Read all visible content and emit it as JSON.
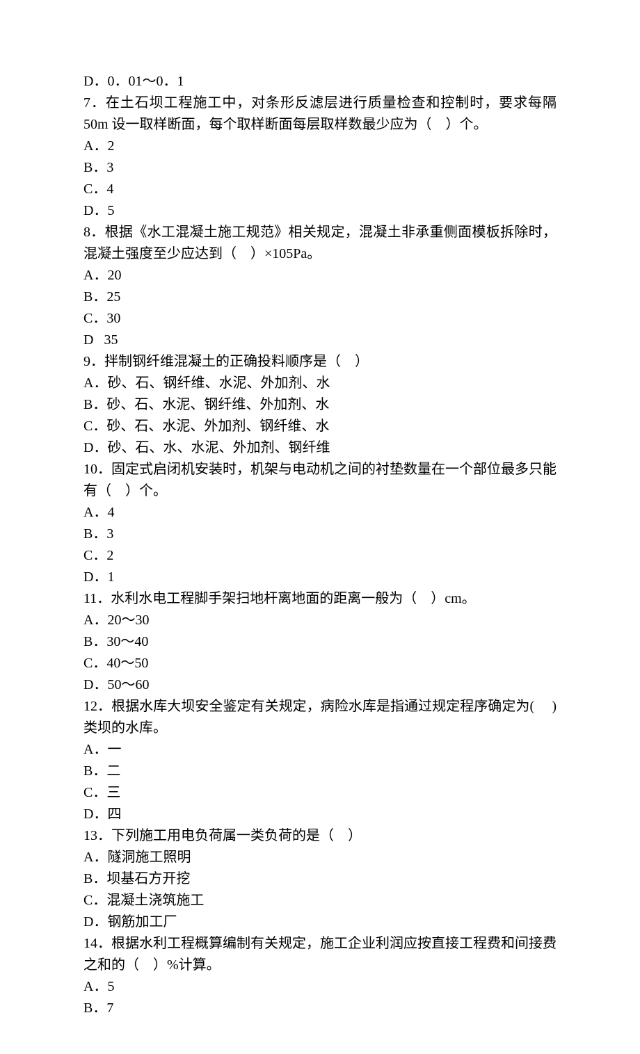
{
  "q6_tail": {
    "optD": "D．0．01～0．1"
  },
  "q7": {
    "stem": "7．在土石坝工程施工中，对条形反滤层进行质量检查和控制时，要求每隔 50m 设一取样断面，每个取样断面每层取样数最少应为（    ）个。",
    "A": "A．2",
    "B": "B．3",
    "C": "C．4",
    "D": "D．5"
  },
  "q8": {
    "stem": "8．根据《水工混凝土施工规范》相关规定，混凝土非承重侧面模板拆除时，混凝土强度至少应达到（    ）×105Pa。",
    "A": "A．20",
    "B": "B．25",
    "C": "C．30",
    "D": "D   35"
  },
  "q9": {
    "stem": "9．拌制钢纤维混凝土的正确投料顺序是（    ）",
    "A": "A．砂、石、钢纤维、水泥、外加剂、水",
    "B": "B．砂、石、水泥、钢纤维、外加剂、水",
    "C": "C．砂、石、水泥、外加剂、钢纤维、水",
    "D": "D．砂、石、水、水泥、外加剂、钢纤维"
  },
  "q10": {
    "stem": "10．固定式启闭机安装时，机架与电动机之间的衬垫数量在一个部位最多只能有（    ）个。",
    "A": "A．4",
    "B": "B．3",
    "C": "C．2",
    "D": "D．1"
  },
  "q11": {
    "stem": "11．水利水电工程脚手架扫地杆离地面的距离一般为（    ）cm。",
    "A": "A．20～30",
    "B": "B．30～40",
    "C": "C．40～50",
    "D": "D．50～60"
  },
  "q12": {
    "stem": "12．根据水库大坝安全鉴定有关规定，病险水库是指通过规定程序确定为(     )类坝的水库。",
    "A": "A．一",
    "B": "B．二",
    "C": "C．三",
    "D": "D．四"
  },
  "q13": {
    "stem": "13．下列施工用电负荷属一类负荷的是（    ）",
    "A": "A．隧洞施工照明",
    "B": "B．坝基石方开挖",
    "C": "C．混凝土浇筑施工",
    "D": "D．钢筋加工厂"
  },
  "q14": {
    "stem": "14．根据水利工程概算编制有关规定，施工企业利润应按直接工程费和间接费之和的（    ）%计算。",
    "A": "A．5",
    "B": "B．7"
  }
}
